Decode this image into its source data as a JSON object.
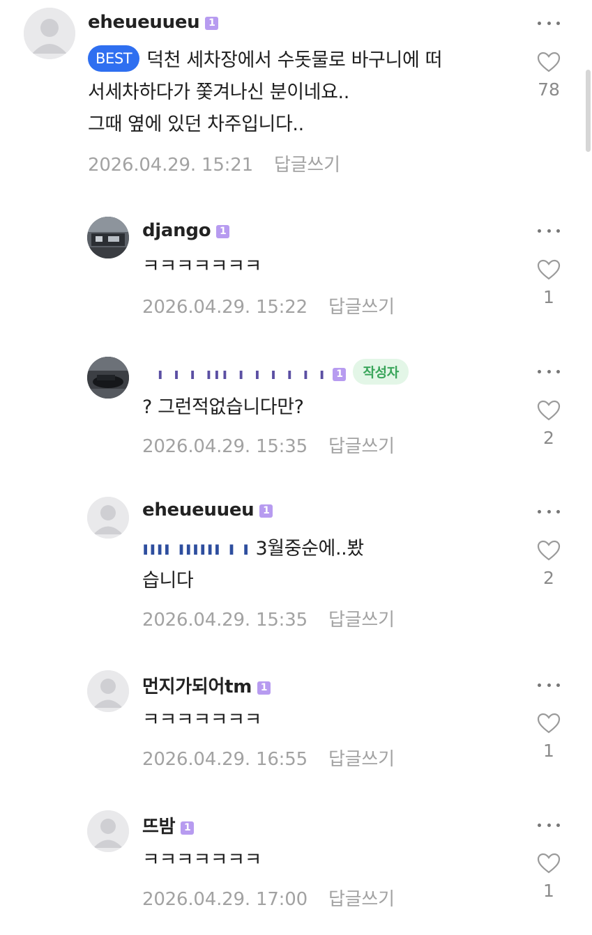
{
  "colors": {
    "best_badge": "#2f6ff0",
    "level_badge": "#b79bf0",
    "author_badge_bg": "#e3f6e7",
    "author_badge_text": "#39a55a",
    "meta_text": "#a2a2a2"
  },
  "icons": {
    "more": "more-dots-icon",
    "like": "heart-icon",
    "avatar_placeholder": "default-avatar-icon"
  },
  "comments": [
    {
      "author": "eheueuueu",
      "level": "1",
      "best_label": "BEST",
      "text_lines": [
        "덕천 세차장에서 수돗물로 바구니에 떠",
        "서세차하다가 쫓겨나신 분이네요..",
        "그때 옆에 있던 차주입니다.."
      ],
      "date": "2026.04.29. 15:21",
      "reply_label": "답글쓰기",
      "likes": "78"
    },
    {
      "author": "django",
      "level": "1",
      "text_lines": [
        "ㅋㅋㅋㅋㅋㅋㅋ"
      ],
      "date": "2026.04.29. 15:22",
      "reply_label": "답글쓰기",
      "likes": "1"
    },
    {
      "author": "ı ı ı ııı ı ı ı ı ı ı",
      "level": "1",
      "author_badge": "작성자",
      "text_lines": [
        "? 그런적없습니다만?"
      ],
      "date": "2026.04.29. 15:35",
      "reply_label": "답글쓰기",
      "likes": "2"
    },
    {
      "author": "eheueuueu",
      "level": "1",
      "mention": "ıııı ıııııı ı ı",
      "text_lines": [
        "3월중순에..봤",
        "습니다"
      ],
      "date": "2026.04.29. 15:35",
      "reply_label": "답글쓰기",
      "likes": "2"
    },
    {
      "author": "먼지가되어tm",
      "level": "1",
      "text_lines": [
        "ㅋㅋㅋㅋㅋㅋㅋ"
      ],
      "date": "2026.04.29. 16:55",
      "reply_label": "답글쓰기",
      "likes": "1"
    },
    {
      "author": "뜨밤",
      "level": "1",
      "text_lines": [
        "ㅋㅋㅋㅋㅋㅋㅋ"
      ],
      "date": "2026.04.29. 17:00",
      "reply_label": "답글쓰기",
      "likes": "1"
    }
  ]
}
